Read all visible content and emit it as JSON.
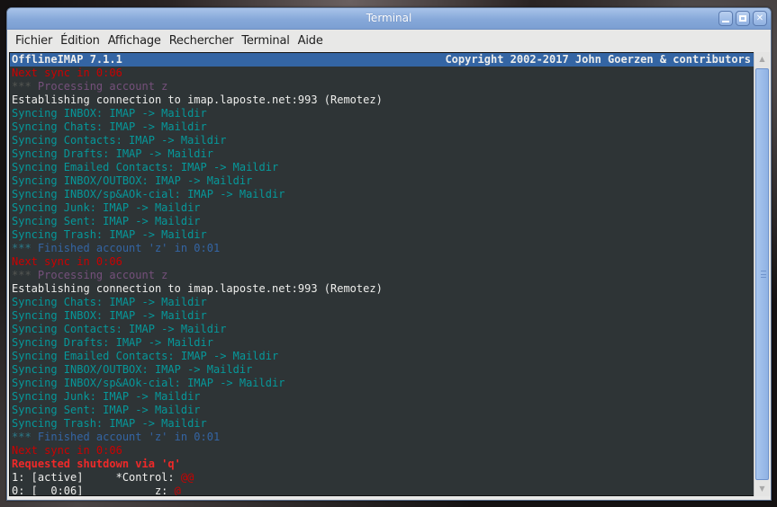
{
  "window": {
    "title": "Terminal",
    "buttons": {
      "minimize": "minimize",
      "maximize": "maximize",
      "close": "✕"
    }
  },
  "menubar": {
    "items": [
      "Fichier",
      "Édition",
      "Affichage",
      "Rechercher",
      "Terminal",
      "Aide"
    ]
  },
  "terminal": {
    "header": {
      "left": "OfflineIMAP 7.1.1",
      "right": "Copyright 2002-2017 John Goerzen & contributors"
    },
    "lines": [
      {
        "type": "red",
        "text": "Next sync in 0:06"
      },
      {
        "type": "processing",
        "stars": "***",
        "text": " Processing account z"
      },
      {
        "type": "white",
        "text": "Establishing connection to imap.laposte.net:993 (Remotez)"
      },
      {
        "type": "teal",
        "text": "Syncing INBOX: IMAP -> Maildir"
      },
      {
        "type": "teal",
        "text": "Syncing Chats: IMAP -> Maildir"
      },
      {
        "type": "teal",
        "text": "Syncing Contacts: IMAP -> Maildir"
      },
      {
        "type": "teal",
        "text": "Syncing Drafts: IMAP -> Maildir"
      },
      {
        "type": "teal",
        "text": "Syncing Emailed Contacts: IMAP -> Maildir"
      },
      {
        "type": "teal",
        "text": "Syncing INBOX/OUTBOX: IMAP -> Maildir"
      },
      {
        "type": "teal",
        "text": "Syncing INBOX/sp&AOk-cial: IMAP -> Maildir"
      },
      {
        "type": "teal",
        "text": "Syncing Junk: IMAP -> Maildir"
      },
      {
        "type": "teal",
        "text": "Syncing Sent: IMAP -> Maildir"
      },
      {
        "type": "teal",
        "text": "Syncing Trash: IMAP -> Maildir"
      },
      {
        "type": "finished",
        "stars": "***",
        "text": " Finished account 'z' in 0:01"
      },
      {
        "type": "red",
        "text": "Next sync in 0:06"
      },
      {
        "type": "processing",
        "stars": "***",
        "text": " Processing account z"
      },
      {
        "type": "white",
        "text": "Establishing connection to imap.laposte.net:993 (Remotez)"
      },
      {
        "type": "teal",
        "text": "Syncing Chats: IMAP -> Maildir"
      },
      {
        "type": "teal",
        "text": "Syncing INBOX: IMAP -> Maildir"
      },
      {
        "type": "teal",
        "text": "Syncing Contacts: IMAP -> Maildir"
      },
      {
        "type": "teal",
        "text": "Syncing Drafts: IMAP -> Maildir"
      },
      {
        "type": "teal",
        "text": "Syncing Emailed Contacts: IMAP -> Maildir"
      },
      {
        "type": "teal",
        "text": "Syncing INBOX/OUTBOX: IMAP -> Maildir"
      },
      {
        "type": "teal",
        "text": "Syncing INBOX/sp&AOk-cial: IMAP -> Maildir"
      },
      {
        "type": "teal",
        "text": "Syncing Junk: IMAP -> Maildir"
      },
      {
        "type": "teal",
        "text": "Syncing Sent: IMAP -> Maildir"
      },
      {
        "type": "teal",
        "text": "Syncing Trash: IMAP -> Maildir"
      },
      {
        "type": "finished",
        "stars": "***",
        "text": " Finished account 'z' in 0:01"
      },
      {
        "type": "red",
        "text": "Next sync in 0:06"
      },
      {
        "type": "bred",
        "text": "Requested shutdown via 'q'"
      }
    ],
    "status_lines": [
      {
        "left": "1: [active]     *Control: ",
        "marker": "@@"
      },
      {
        "left": "0: [  0:06]           z: ",
        "marker": "@"
      }
    ]
  },
  "colors": {
    "terminal_bg": "#2e3436",
    "header_bg": "#3465a4",
    "red": "#cc0000",
    "bold_red": "#ef2929",
    "purple": "#75507b",
    "teal": "#06989a",
    "blue": "#3465a4",
    "foreground": "#eeeeec",
    "titlebar": "#86a8d9"
  },
  "scrollbar": {
    "up_arrow": "▲",
    "down_arrow": "▼",
    "position_fraction": 1.0
  }
}
